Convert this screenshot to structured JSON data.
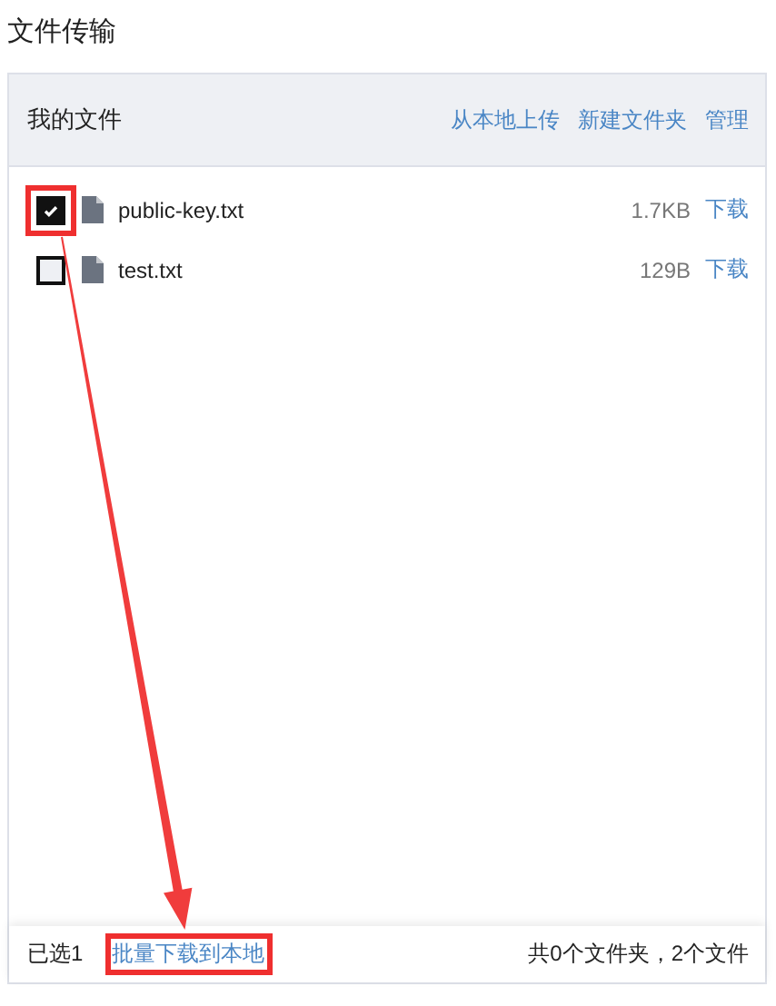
{
  "title": "文件传输",
  "panel": {
    "heading": "我的文件",
    "actions": [
      "从本地上传",
      "新建文件夹",
      "管理"
    ]
  },
  "files": [
    {
      "name": "public-key.txt",
      "size": "1.7KB",
      "action": "下载",
      "checked": true,
      "highlighted": true
    },
    {
      "name": "test.txt",
      "size": "129B",
      "action": "下载",
      "checked": false,
      "highlighted": false
    }
  ],
  "footer": {
    "selected": "已选1",
    "batch_link": "批量下载到本地",
    "batch_highlighted": true,
    "summary": "共0个文件夹，2个文件"
  }
}
